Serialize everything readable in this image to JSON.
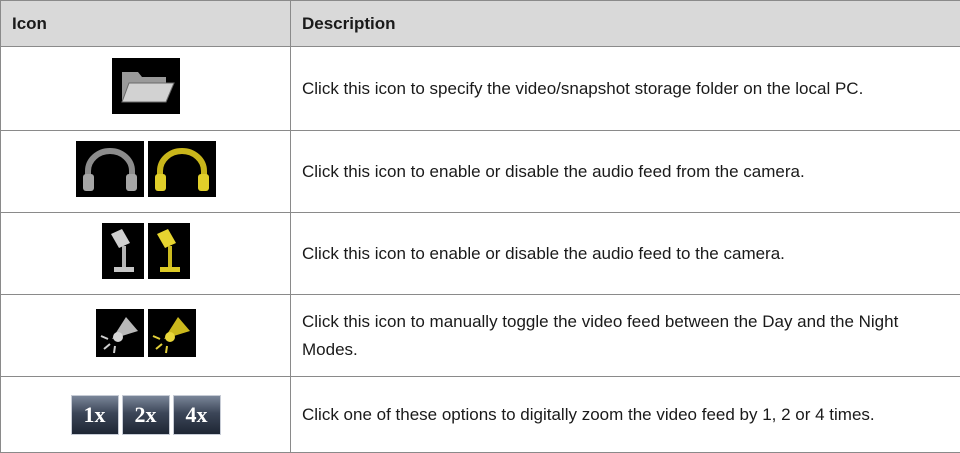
{
  "table": {
    "headers": {
      "icon": "Icon",
      "description": "Description"
    },
    "rows": [
      {
        "icons": [
          "folder-icon"
        ],
        "description": "Click this icon to specify the video/snapshot storage folder on the local PC."
      },
      {
        "icons": [
          "headphones-gray-icon",
          "headphones-yellow-icon"
        ],
        "description": "Click this icon to enable or disable the audio feed from the camera."
      },
      {
        "icons": [
          "microphone-gray-icon",
          "microphone-yellow-icon"
        ],
        "description": "Click this icon to enable or disable the audio feed to the camera."
      },
      {
        "icons": [
          "lamp-gray-icon",
          "lamp-yellow-icon"
        ],
        "description": "Click this icon to manually toggle the video feed between the Day and the Night Modes."
      },
      {
        "zoom_options": [
          "1x",
          "2x",
          "4x"
        ],
        "description": "Click one of these options to digitally zoom the video feed by 1, 2 or 4 times."
      }
    ]
  },
  "colors": {
    "header_bg": "#d9d9d9",
    "border": "#8a8a8a",
    "icon_gray": "#8c8c8c",
    "icon_yellow": "#d4c21e",
    "zoom_button": "#3c4658"
  }
}
